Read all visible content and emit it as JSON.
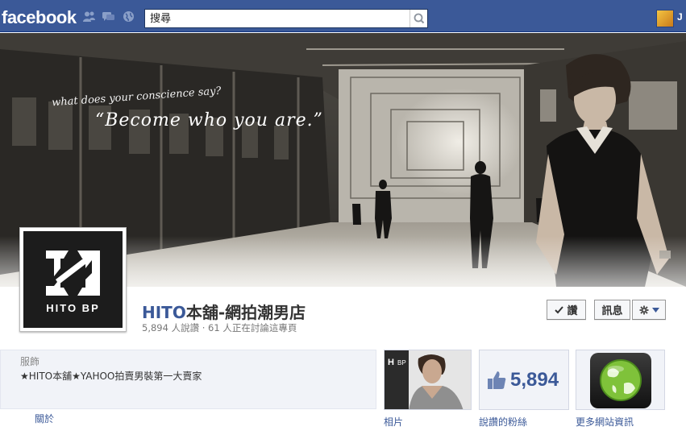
{
  "topbar": {
    "logo": "facebook",
    "search_placeholder": "搜尋",
    "profile_name": "J"
  },
  "cover": {
    "caption_line1": "what does your conscience say?",
    "caption_line2": "“Become who you are.”"
  },
  "profile": {
    "logo_text": "HITO BP",
    "title_brand": "HITO",
    "title_rest": "本舖-網拍潮男店",
    "stats": "5,894 人說讚 · 61 人正在討論這專頁"
  },
  "actions": {
    "like_label": "讚",
    "message_label": "訊息"
  },
  "info": {
    "category": "服飾",
    "description": "★HITO本舖★YAHOO拍賣男裝第一大賣家",
    "about_label": "關於"
  },
  "apps": {
    "photos_label": "相片",
    "likes_count": "5,894",
    "likes_label": "說讚的粉絲",
    "website_label": "更多網站資訊"
  },
  "colors": {
    "brand_blue": "#3b5998",
    "topbar_border": "#133783",
    "tile_bg": "#f1f3f8"
  }
}
